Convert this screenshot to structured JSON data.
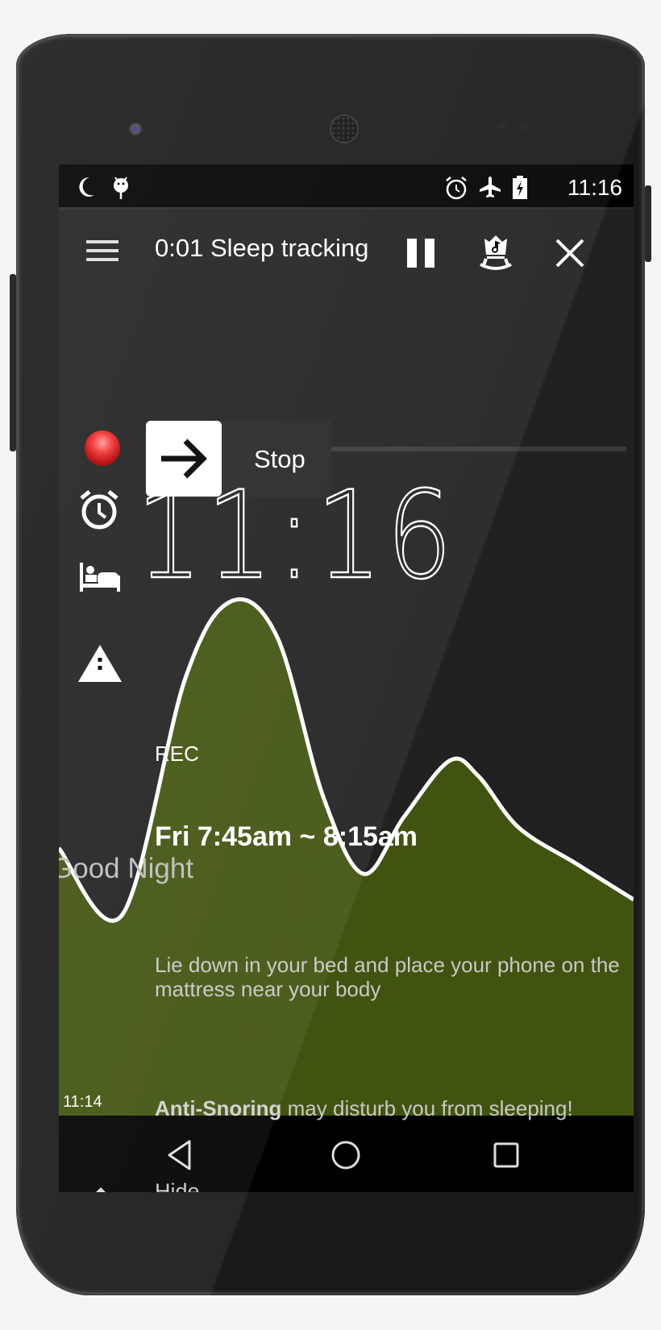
{
  "statusbar": {
    "left_icons": [
      "moon-icon",
      "android-icon"
    ],
    "right_icons": [
      "alarm-icon",
      "airplane-mode-icon",
      "battery-charging-icon"
    ],
    "time": "11:16"
  },
  "toolbar": {
    "menu_icon": "hamburger-menu-icon",
    "title": "0:01 Sleep tracking",
    "pause_icon": "pause-icon",
    "lullaby_icon": "lullaby-cradle-icon",
    "close_icon": "close-icon"
  },
  "tracking": {
    "stop_label": "Stop",
    "stop_icon": "arrow-right-icon",
    "clock": "11:16"
  },
  "recording": {
    "label": "REC",
    "progress": 0.1,
    "fill_color": "#6b7a2e"
  },
  "alarm": {
    "icon": "alarm-clock-icon",
    "time_range": "Fri 7:45am ~ 8:15am",
    "greeting": "Good Night"
  },
  "hint": {
    "icon": "bed-icon",
    "text": "Lie down in your bed and place your phone on the mattress near your body"
  },
  "warning": {
    "icon": "warning-icon",
    "bold": "Anti-Snoring",
    "text": " may disturb you from sleeping!"
  },
  "hide": {
    "icon": "caret-up-icon",
    "label": "Hide"
  },
  "chart_data": {
    "type": "area",
    "title": "",
    "xlabel": "",
    "ylabel": "",
    "start_time_label": "11:14",
    "x": [
      0,
      0.11,
      0.22,
      0.3,
      0.38,
      0.46,
      0.53,
      0.6,
      0.68,
      0.73,
      0.8,
      0.9,
      1.0
    ],
    "values": [
      0.52,
      0.39,
      0.85,
      1.0,
      0.93,
      0.62,
      0.47,
      0.58,
      0.69,
      0.66,
      0.56,
      0.49,
      0.42
    ],
    "ylim": [
      0,
      1.05
    ],
    "fill_color": "#41540f",
    "line_color": "#ffffff"
  },
  "navbar": {
    "back": "back-icon",
    "home": "home-icon",
    "recents": "recents-icon"
  }
}
